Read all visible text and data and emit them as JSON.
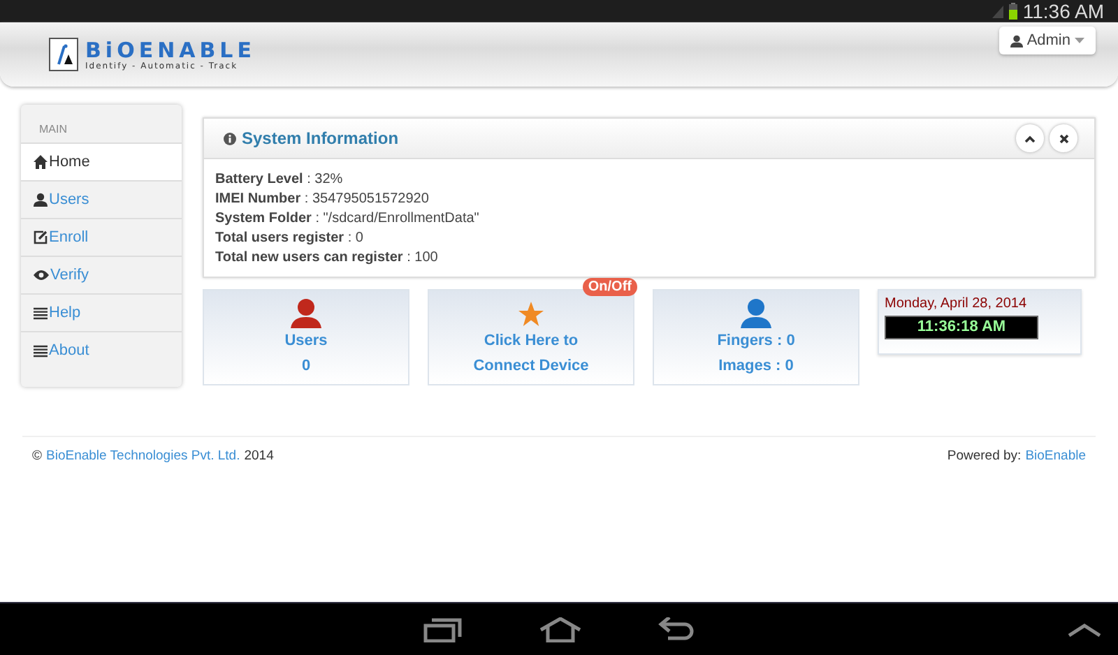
{
  "status_bar": {
    "time": "11:36 AM"
  },
  "header": {
    "logo": {
      "name": "BiOENABLE",
      "tagline": "Identify - Automatic - Track"
    },
    "user_menu": "Admin"
  },
  "sidebar": {
    "heading": "MAIN",
    "items": [
      {
        "label": "Home",
        "selected": true
      },
      {
        "label": "Users",
        "selected": false
      },
      {
        "label": "Enroll",
        "selected": false
      },
      {
        "label": "Verify",
        "selected": false
      },
      {
        "label": "Help",
        "selected": false
      },
      {
        "label": "About",
        "selected": false
      }
    ]
  },
  "system_panel": {
    "title": "System Information",
    "fields": [
      "**Battery Level** : 32%",
      "**IMEI Number** : 354795051572920",
      "**System Folder** : \"/sdcard/EnrollmentData\"",
      "**Total users register** : 0",
      "**Total new users can register** : 100"
    ]
  },
  "tiles": [
    {
      "kind": "users",
      "lines": [
        "Users",
        "0"
      ]
    },
    {
      "kind": "connect",
      "lines": [
        "Click Here to",
        "Connect Device"
      ],
      "badge": "On/Off"
    },
    {
      "kind": "fingers",
      "lines": [
        "Fingers : 0",
        "Images : 0"
      ]
    },
    {
      "kind": "clock",
      "date": "Monday, April 28, 2014",
      "time": "11:36:18 AM"
    }
  ],
  "footer": {
    "copyright": "©",
    "company": "BioEnable Technologies Pvt. Ltd.",
    "year": "2014",
    "powered_label": "Powered by:",
    "powered_link": "BioEnable"
  }
}
